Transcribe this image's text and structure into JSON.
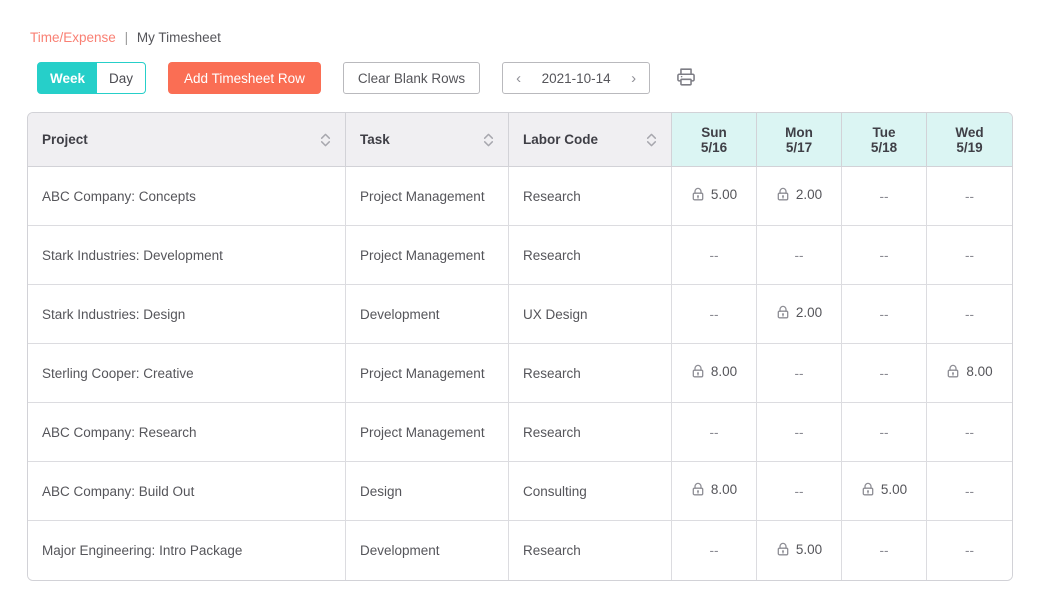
{
  "breadcrumb": {
    "link": "Time/Expense",
    "separator": "|",
    "current": "My Timesheet"
  },
  "toolbar": {
    "toggle": {
      "week_label": "Week",
      "day_label": "Day",
      "selected": "Week"
    },
    "add_row_label": "Add Timesheet Row",
    "clear_blank_label": "Clear Blank Rows",
    "date_nav": {
      "prev_icon": "chevron-left-icon",
      "date": "2021-10-14",
      "next_icon": "chevron-right-icon"
    },
    "print_icon": "printer-icon"
  },
  "colors": {
    "accent_teal": "#26cfc9",
    "accent_coral": "#fa6e54",
    "breadcrumb_link": "#f98074",
    "header_gray": "#f0eff2",
    "day_header_cyan": "#dbf5f3",
    "border_gray": "#d2d2d7",
    "text_gray": "#55555a"
  },
  "table": {
    "columns": [
      {
        "label": "Project",
        "sortable": true,
        "type": "text"
      },
      {
        "label": "Task",
        "sortable": true,
        "type": "text"
      },
      {
        "label": "Labor Code",
        "sortable": true,
        "type": "text"
      },
      {
        "day": "Sun",
        "date": "5/16",
        "sortable": false,
        "type": "day"
      },
      {
        "day": "Mon",
        "date": "5/17",
        "sortable": false,
        "type": "day"
      },
      {
        "day": "Tue",
        "date": "5/18",
        "sortable": false,
        "type": "day"
      },
      {
        "day": "Wed",
        "date": "5/19",
        "sortable": false,
        "type": "day"
      }
    ],
    "empty_value": "--",
    "lock_icon": "lock-icon",
    "rows": [
      {
        "project": "ABC Company: Concepts",
        "task": "Project Management",
        "labor_code": "Research",
        "days": [
          {
            "value": "5.00",
            "locked": true
          },
          {
            "value": "2.00",
            "locked": true
          },
          {
            "value": "--",
            "locked": false
          },
          {
            "value": "--",
            "locked": false
          }
        ]
      },
      {
        "project": "Stark Industries: Development",
        "task": "Project Management",
        "labor_code": "Research",
        "days": [
          {
            "value": "--",
            "locked": false
          },
          {
            "value": "--",
            "locked": false
          },
          {
            "value": "--",
            "locked": false
          },
          {
            "value": "--",
            "locked": false
          }
        ]
      },
      {
        "project": "Stark Industries: Design",
        "task": "Development",
        "labor_code": "UX Design",
        "days": [
          {
            "value": "--",
            "locked": false
          },
          {
            "value": "2.00",
            "locked": true
          },
          {
            "value": "--",
            "locked": false
          },
          {
            "value": "--",
            "locked": false
          }
        ]
      },
      {
        "project": "Sterling Cooper: Creative",
        "task": "Project Management",
        "labor_code": "Research",
        "days": [
          {
            "value": "8.00",
            "locked": true
          },
          {
            "value": "--",
            "locked": false
          },
          {
            "value": "--",
            "locked": false
          },
          {
            "value": "8.00",
            "locked": true
          }
        ]
      },
      {
        "project": "ABC Company: Research",
        "task": "Project Management",
        "labor_code": "Research",
        "days": [
          {
            "value": "--",
            "locked": false
          },
          {
            "value": "--",
            "locked": false
          },
          {
            "value": "--",
            "locked": false
          },
          {
            "value": "--",
            "locked": false
          }
        ]
      },
      {
        "project": "ABC Company: Build Out",
        "task": "Design",
        "labor_code": "Consulting",
        "days": [
          {
            "value": "8.00",
            "locked": true
          },
          {
            "value": "--",
            "locked": false
          },
          {
            "value": "5.00",
            "locked": true
          },
          {
            "value": "--",
            "locked": false
          }
        ]
      },
      {
        "project": "Major Engineering: Intro Package",
        "task": "Development",
        "labor_code": "Research",
        "days": [
          {
            "value": "--",
            "locked": false
          },
          {
            "value": "5.00",
            "locked": true
          },
          {
            "value": "--",
            "locked": false
          },
          {
            "value": "--",
            "locked": false
          }
        ]
      }
    ]
  }
}
